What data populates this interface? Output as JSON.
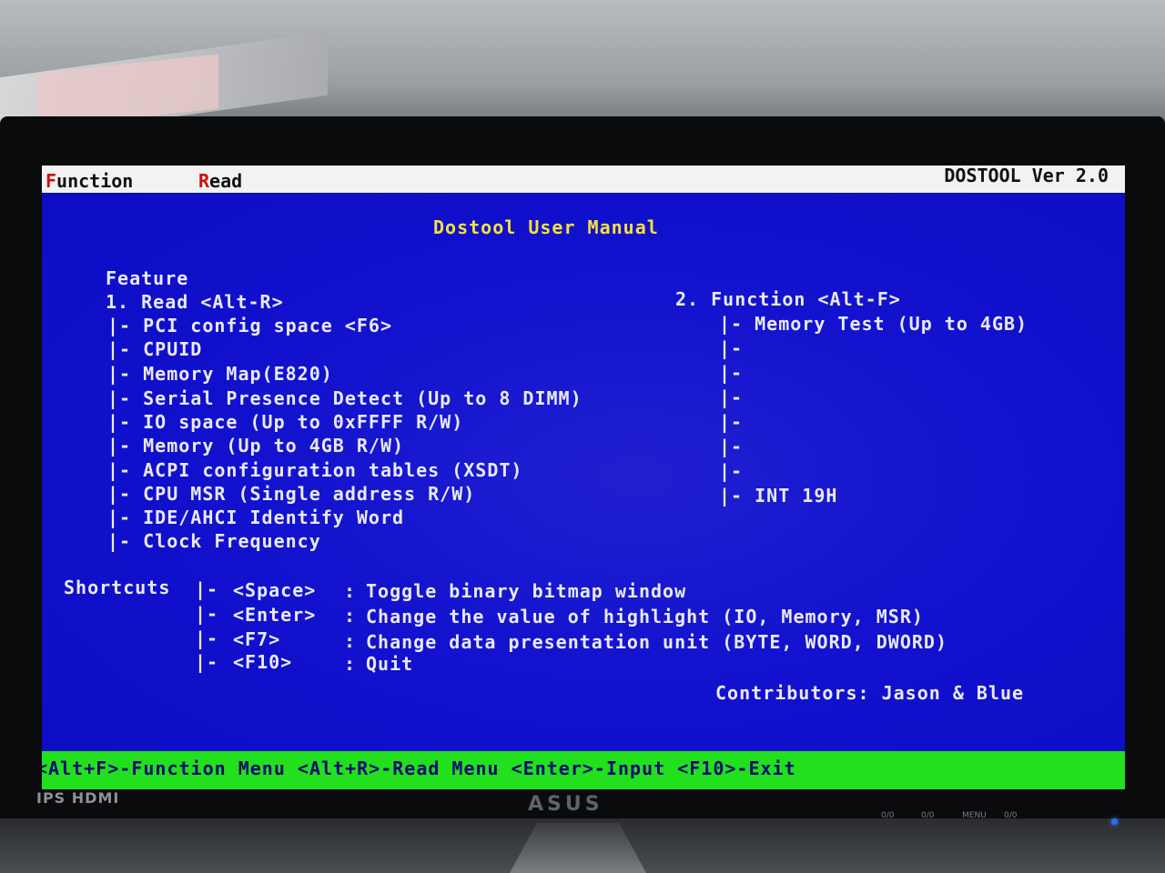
{
  "menu": {
    "function": {
      "hot": "F",
      "rest": "unction"
    },
    "read": {
      "hot": "R",
      "rest": "ead"
    }
  },
  "version": "DOSTOOL Ver 2.0",
  "title": "Dostool User Manual",
  "feature_heading": "Feature",
  "read_section": {
    "heading": "1. Read <Alt-R>",
    "items": [
      "|- PCI config space <F6>",
      "|- CPUID",
      "|- Memory Map(E820)",
      "|- Serial Presence Detect (Up to 8 DIMM)",
      "|- IO space (Up to 0xFFFF R/W)",
      "|- Memory (Up to 4GB R/W)",
      "|- ACPI configuration tables (XSDT)",
      "|- CPU MSR (Single address R/W)",
      "|- IDE/AHCI Identify Word",
      "|- Clock Frequency"
    ]
  },
  "function_section": {
    "heading": "2. Function <Alt-F>",
    "items": [
      "|- Memory Test (Up to 4GB)",
      "|-",
      "|-",
      "|-",
      "|-",
      "|-",
      "|-",
      "|- INT 19H"
    ]
  },
  "shortcuts": {
    "label": "Shortcuts",
    "rows": [
      {
        "prefix": "|-",
        "key": "<Space>",
        "sep": ":",
        "desc": "Toggle binary bitmap window"
      },
      {
        "prefix": "|-",
        "key": "<Enter>",
        "sep": ":",
        "desc": "Change the value of highlight (IO, Memory, MSR)"
      },
      {
        "prefix": "|-",
        "key": "<F7>",
        "sep": ":",
        "desc": "Change data presentation unit (BYTE, WORD, DWORD)"
      },
      {
        "prefix": "|-",
        "key": "<F10>",
        "sep": ":",
        "desc": "Quit"
      }
    ]
  },
  "contributors": "Contributors: Jason & Blue",
  "statusbar": "<Alt+F>-Function Menu <Alt+R>-Read Menu <Enter>-Input <F10>-Exit",
  "monitor": {
    "brand_left": "IPS HDMI",
    "brand_center": "ASUS",
    "button_labels": [
      "0/0",
      "0/0",
      "MENU",
      "0/0"
    ]
  },
  "colors": {
    "screen_bg": "#1212cf",
    "title": "#f3e13a",
    "text": "#e9e9f5",
    "statusbar_bg": "#22e01e",
    "menubar_bg": "#f2f2f2",
    "hotkey": "#cc1010"
  }
}
